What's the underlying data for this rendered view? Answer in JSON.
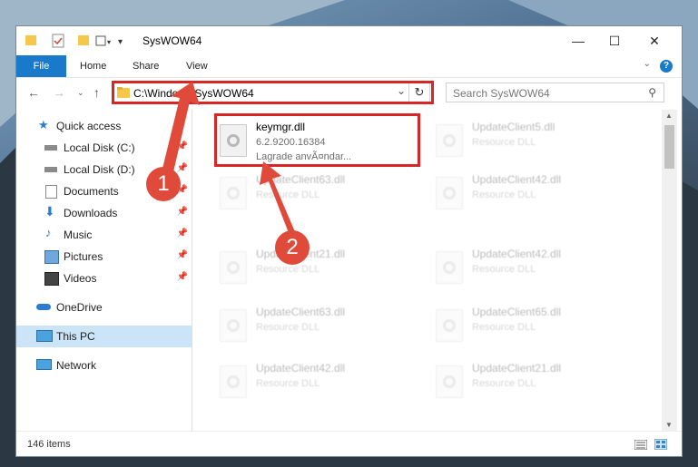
{
  "window": {
    "title": "SysWOW64"
  },
  "ribbon": {
    "tabs": [
      "File",
      "Home",
      "Share",
      "View"
    ],
    "help": "?"
  },
  "controls": {
    "minimize": "—",
    "maximize": "☐",
    "close": "✕"
  },
  "address": {
    "path": "C:\\Windows\\SysWOW64",
    "refresh": "↻",
    "dropdown": "⌄"
  },
  "search": {
    "placeholder": "Search SysWOW64"
  },
  "sidebar": {
    "items": [
      {
        "label": "Quick access",
        "icon": "star-icon"
      },
      {
        "label": "Local Disk (C:)",
        "icon": "drive-icon",
        "pinned": true
      },
      {
        "label": "Local Disk (D:)",
        "icon": "drive-icon",
        "pinned": true
      },
      {
        "label": "Documents",
        "icon": "documents-icon",
        "pinned": true
      },
      {
        "label": "Downloads",
        "icon": "downloads-icon",
        "pinned": true
      },
      {
        "label": "Music",
        "icon": "music-icon",
        "pinned": true
      },
      {
        "label": "Pictures",
        "icon": "pictures-icon",
        "pinned": true
      },
      {
        "label": "Videos",
        "icon": "videos-icon",
        "pinned": true
      },
      {
        "label": "OneDrive",
        "icon": "cloud-icon"
      },
      {
        "label": "This PC",
        "icon": "computer-icon",
        "selected": true
      },
      {
        "label": "Network",
        "icon": "network-icon"
      }
    ]
  },
  "files": {
    "highlighted": {
      "name": "keymgr.dll",
      "version": "6.2.9200.16384",
      "desc": "Lagrade anvÃ¤ndar..."
    },
    "tiles": [
      {
        "name": "UpdateClient5.dll",
        "desc": "Resource DLL"
      },
      {
        "name": "UpdateClient63.dll",
        "desc": "Resource DLL"
      },
      {
        "name": "UpdateClient42.dll",
        "desc": "Resource DLL"
      },
      {
        "name": "UpdateClient21.dll",
        "desc": "Resource DLL"
      },
      {
        "name": "UpdateClient42.dll",
        "desc": "Resource DLL"
      },
      {
        "name": "UpdateClient63.dll",
        "desc": "Resource DLL"
      },
      {
        "name": "UpdateClient65.dll",
        "desc": "Resource DLL"
      },
      {
        "name": "UpdateClient42.dll",
        "desc": "Resource DLL"
      },
      {
        "name": "UpdateClient21.dll",
        "desc": "Resource DLL"
      }
    ]
  },
  "status": {
    "count": "146 items"
  },
  "callouts": [
    "1",
    "2"
  ],
  "colors": {
    "accent": "#1979ca",
    "highlight": "#d82626",
    "callout": "#e04a3a",
    "selected": "#cce4f7"
  }
}
